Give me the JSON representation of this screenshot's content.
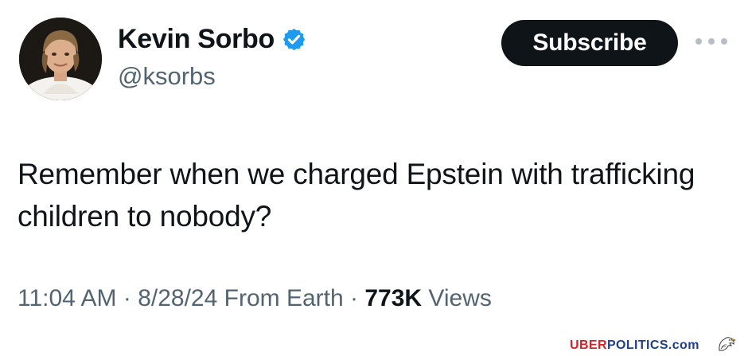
{
  "author": {
    "display_name": "Kevin Sorbo",
    "handle": "@ksorbs",
    "verified": true,
    "avatar_icon": "profile-photo"
  },
  "actions": {
    "subscribe_label": "Subscribe",
    "more_icon": "more-options-icon"
  },
  "tweet": {
    "text": "Remember when we charged Epstein with trafficking children to nobody?"
  },
  "meta": {
    "time": "11:04 AM",
    "sep1": " · ",
    "date": "8/28/24",
    "source": " From Earth",
    "sep2": " · ",
    "views_count": "773K",
    "views_label": " Views"
  },
  "watermark": {
    "uber": "UBER",
    "politics": "POLITICS.com"
  },
  "colors": {
    "text_primary": "#0f1419",
    "text_secondary": "#536471",
    "verified_blue": "#1d9bf0",
    "button_bg": "#0f1419",
    "watermark_red": "#d4242a",
    "watermark_blue": "#1f3f8f"
  }
}
